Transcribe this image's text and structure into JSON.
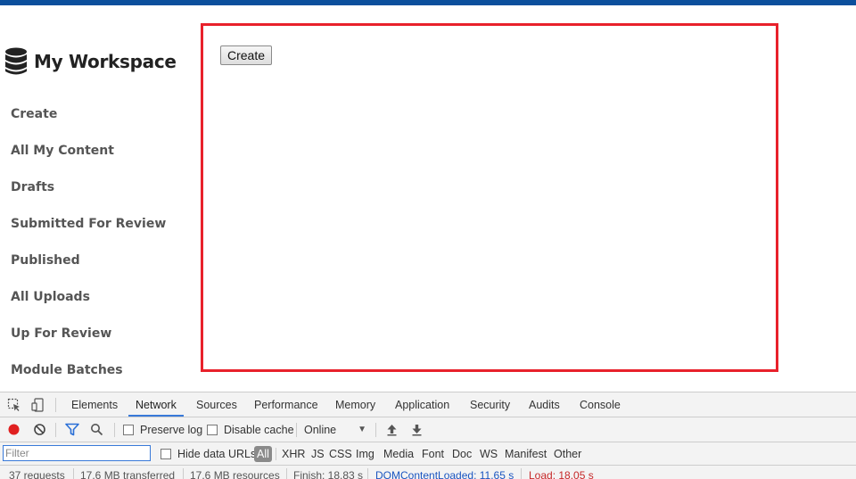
{
  "app": {
    "title": "My Workspace",
    "logo_icon": "database-icon"
  },
  "sidebar": {
    "items": [
      {
        "label": "Create"
      },
      {
        "label": "All My Content"
      },
      {
        "label": "Drafts"
      },
      {
        "label": "Submitted For Review"
      },
      {
        "label": "Published"
      },
      {
        "label": "All Uploads"
      },
      {
        "label": "Up For Review"
      },
      {
        "label": "Module Batches"
      }
    ]
  },
  "main": {
    "create_button_label": "Create",
    "highlight_color": "#e8212b"
  },
  "devtools": {
    "tabs": [
      "Elements",
      "Network",
      "Sources",
      "Performance",
      "Memory",
      "Application",
      "Security",
      "Audits",
      "Console"
    ],
    "active_tab": "Network",
    "toolbar": {
      "preserve_log": "Preserve log",
      "disable_cache": "Disable cache",
      "throttle": "Online"
    },
    "filter": {
      "placeholder": "Filter",
      "hide_data_urls": "Hide data URLs",
      "types": [
        "All",
        "XHR",
        "JS",
        "CSS",
        "Img",
        "Media",
        "Font",
        "Doc",
        "WS",
        "Manifest",
        "Other"
      ]
    },
    "status": {
      "requests": "37 requests",
      "transferred": "17.6 MB transferred",
      "resources": "17.6 MB resources",
      "finish": "Finish: 18.83 s",
      "dom_content_loaded": "DOMContentLoaded: 11.65 s",
      "load": "Load: 18.05 s"
    }
  },
  "colors": {
    "accent": "#0b4f9c",
    "devtools_active": "#3879d9",
    "record": "#e02020"
  }
}
